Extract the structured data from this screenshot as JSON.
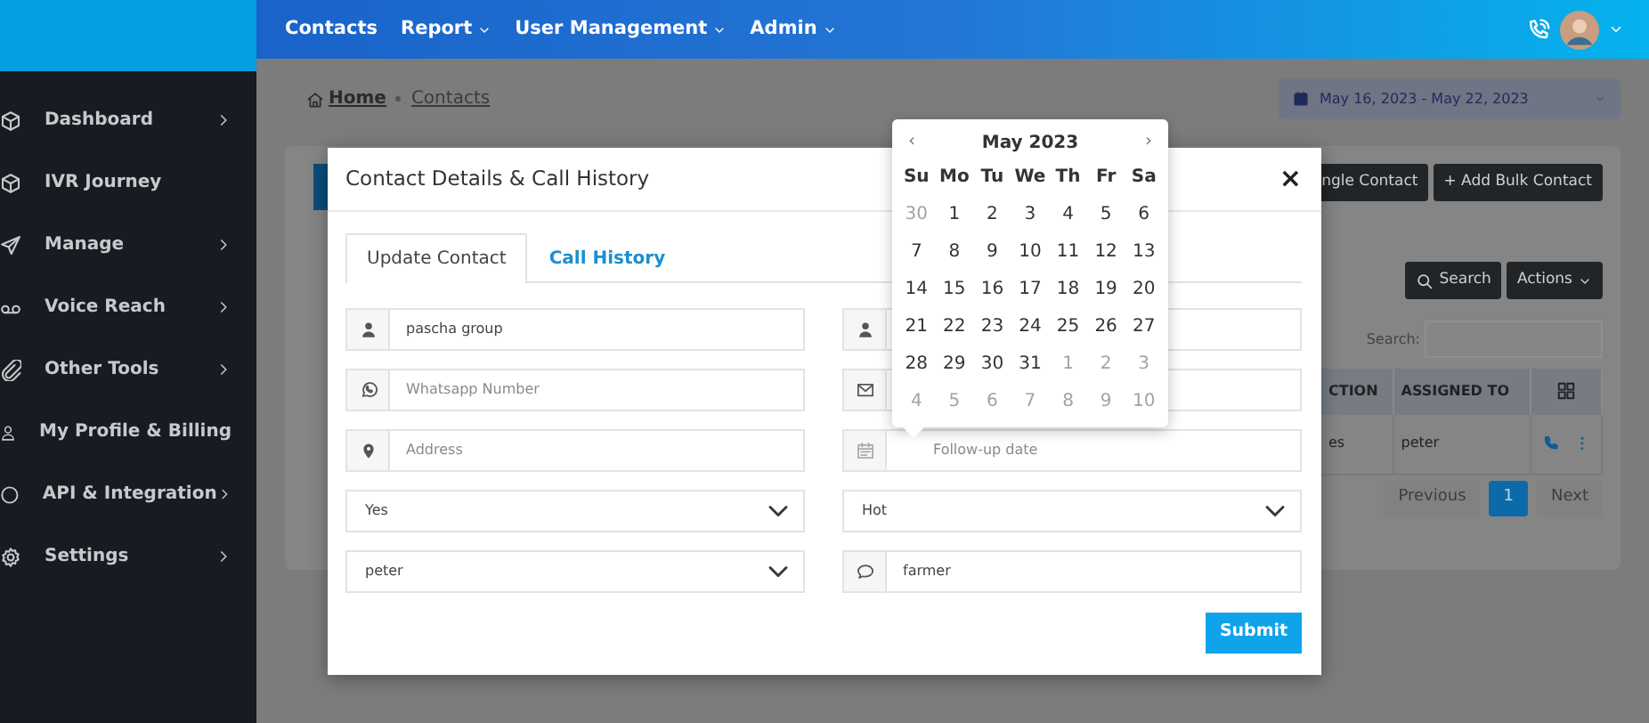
{
  "sidebar": {
    "items": [
      {
        "kind": "cube",
        "label": "Dashboard",
        "has_submenu": true
      },
      {
        "kind": "cube",
        "label": "IVR Journey",
        "has_submenu": false
      },
      {
        "kind": "send",
        "label": "Manage",
        "has_submenu": true
      },
      {
        "kind": "voicemail",
        "label": "Voice Reach",
        "has_submenu": true
      },
      {
        "kind": "clip",
        "label": "Other Tools",
        "has_submenu": true
      },
      {
        "kind": "person",
        "label": "My Profile & Billing",
        "has_submenu": false
      },
      {
        "kind": "ring",
        "label": "API & Integration",
        "has_submenu": true
      },
      {
        "kind": "gear",
        "label": "Settings",
        "has_submenu": true
      }
    ]
  },
  "navbar": {
    "items": [
      {
        "label": "Contacts",
        "dropdown": false
      },
      {
        "label": "Report",
        "dropdown": true
      },
      {
        "label": "User Management",
        "dropdown": true
      },
      {
        "label": "Admin",
        "dropdown": true
      }
    ]
  },
  "breadcrumb": [
    "Home",
    "Contacts"
  ],
  "date_range": "May 16, 2023 - May 22, 2023",
  "background": {
    "buttons": [
      "ngle Contact",
      "+ Add Bulk Contact"
    ],
    "search_button": "Search",
    "actions_button": "Actions",
    "search_label": "Search:",
    "table": {
      "columns": [
        "CTION",
        "ASSIGNED TO"
      ],
      "rows": [
        [
          "es",
          "peter"
        ]
      ]
    },
    "pagination": [
      {
        "label": "Previous",
        "selected": false
      },
      {
        "label": "1",
        "selected": true
      },
      {
        "label": "Next",
        "selected": false
      }
    ]
  },
  "modal": {
    "title": "Contact Details & Call History",
    "close": "×",
    "tabs": [
      {
        "label": "Update Contact",
        "selected": true
      },
      {
        "label": "Call History",
        "selected": false
      }
    ],
    "fields": [
      {
        "kind": "person",
        "value": "pascha group"
      },
      {
        "kind": "person"
      },
      {
        "kind": "phone",
        "placeholder": "Whatsapp Number"
      },
      {
        "kind": "mail"
      },
      {
        "kind": "pin",
        "placeholder": "Address"
      },
      {
        "kind": "date",
        "placeholder": "Follow-up date"
      },
      {
        "kind": "select",
        "value": "Yes"
      },
      {
        "kind": "select",
        "value": "Hot"
      },
      {
        "kind": "select",
        "value": "peter"
      },
      {
        "kind": "note",
        "value": "farmer"
      }
    ],
    "submit": "Submit"
  },
  "datepicker": {
    "prev": "‹",
    "title": "May 2023",
    "next": "›",
    "weekdays": [
      "Su",
      "Mo",
      "Tu",
      "We",
      "Th",
      "Fr",
      "Sa"
    ],
    "weeks": [
      [
        {
          "day": "30",
          "muted": true
        },
        {
          "day": "1",
          "muted": false
        },
        {
          "day": "2",
          "muted": false
        },
        {
          "day": "3",
          "muted": false
        },
        {
          "day": "4",
          "muted": false
        },
        {
          "day": "5",
          "muted": false
        },
        {
          "day": "6",
          "muted": false
        }
      ],
      [
        {
          "day": "7",
          "muted": false
        },
        {
          "day": "8",
          "muted": false
        },
        {
          "day": "9",
          "muted": false
        },
        {
          "day": "10",
          "muted": false
        },
        {
          "day": "11",
          "muted": false
        },
        {
          "day": "12",
          "muted": false
        },
        {
          "day": "13",
          "muted": false
        }
      ],
      [
        {
          "day": "14",
          "muted": false
        },
        {
          "day": "15",
          "muted": false
        },
        {
          "day": "16",
          "muted": false
        },
        {
          "day": "17",
          "muted": false
        },
        {
          "day": "18",
          "muted": false
        },
        {
          "day": "19",
          "muted": false
        },
        {
          "day": "20",
          "muted": false
        }
      ],
      [
        {
          "day": "21",
          "muted": false
        },
        {
          "day": "22",
          "muted": false
        },
        {
          "day": "23",
          "muted": false
        },
        {
          "day": "24",
          "muted": false
        },
        {
          "day": "25",
          "muted": false
        },
        {
          "day": "26",
          "muted": false
        },
        {
          "day": "27",
          "muted": false
        }
      ],
      [
        {
          "day": "28",
          "muted": false
        },
        {
          "day": "29",
          "muted": false
        },
        {
          "day": "30",
          "muted": false
        },
        {
          "day": "31",
          "muted": false
        },
        {
          "day": "1",
          "muted": true
        },
        {
          "day": "2",
          "muted": true
        },
        {
          "day": "3",
          "muted": true
        }
      ],
      [
        {
          "day": "4",
          "muted": true
        },
        {
          "day": "5",
          "muted": true
        },
        {
          "day": "6",
          "muted": true
        },
        {
          "day": "7",
          "muted": true
        },
        {
          "day": "8",
          "muted": true
        },
        {
          "day": "9",
          "muted": true
        },
        {
          "day": "10",
          "muted": true
        }
      ]
    ]
  }
}
